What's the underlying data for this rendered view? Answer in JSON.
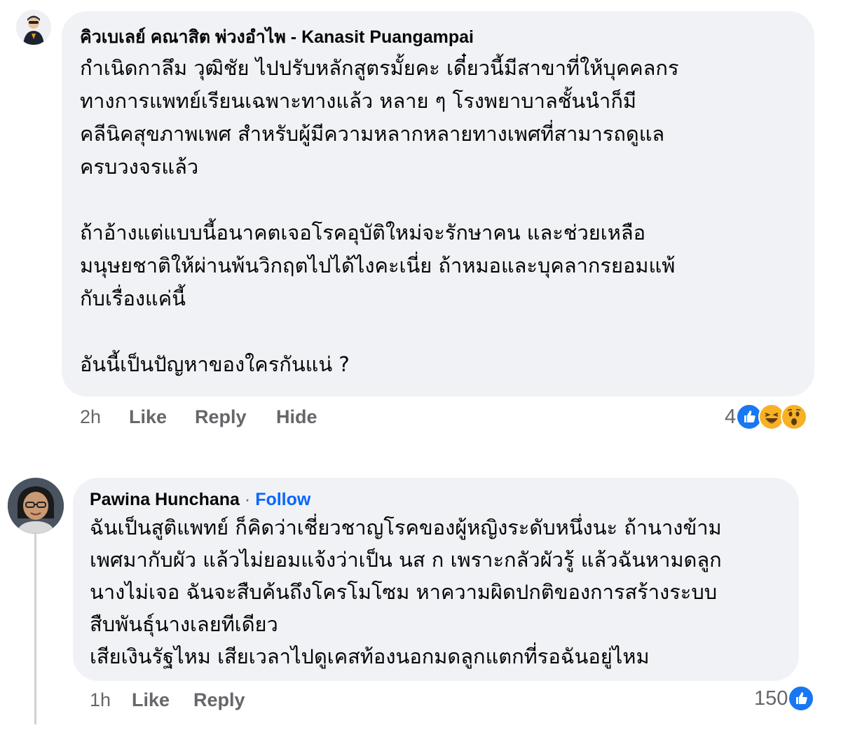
{
  "comments": [
    {
      "author": "คิวเบเลย์ คณาสิต พ่วงอำไพ - Kanasit Puangampai",
      "paragraphs": [
        [
          "กำเนิดกาลึม วุฒิชัย ไปปรับหลักสูตรมั้ยคะ เดี๋ยวนี้มีสาขาที่ให้บุคคลกร",
          "ทางการแพทย์เรียนเฉพาะทางแล้ว หลาย ๆ โรงพยาบาลชั้นนำก็มี",
          "คลีนิคสุขภาพเพศ สำหรับผู้มีความหลากหลายทางเพศที่สามารถดูแล",
          "ครบวงจรแล้ว"
        ],
        [
          "ถ้าอ้างแต่แบบนี้อนาคตเจอโรคอุบัติใหม่จะรักษาคน และช่วยเหลือ",
          "มนุษยชาติให้ผ่านพ้นวิกฤตไปได้ไงคะเนี่ย ถ้าหมอและบุคลากรยอมแพ้",
          "กับเรื่องแค่นี้"
        ],
        [
          "อันนี้เป็นปัญหาของใครกันแน่ ?"
        ]
      ],
      "time": "2h",
      "actions": {
        "like": "Like",
        "reply": "Reply",
        "hide": "Hide"
      },
      "reactions": {
        "count": "4",
        "icons": [
          "like-icon",
          "haha-icon",
          "wow-icon"
        ]
      }
    },
    {
      "author": "Pawina Hunchana",
      "separator": "·",
      "follow": "Follow",
      "lines": [
        "ฉันเป็นสูติแพทย์ ก็คิดว่าเชี่ยวชาญโรคของผู้หญิงระดับหนึ่งนะ ถ้านางข้าม",
        "เพศมากับผัว แล้วไม่ยอมแจ้งว่าเป็น นส ก เพราะกลัวผัวรู้ แล้วฉันหามดลูก",
        "นางไม่เจอ ฉันจะสืบค้นถึงโครโมโซม หาความผิดปกติของการสร้างระบบ",
        "สืบพันธุ์นางเลยทีเดียว",
        "เสียเงินรัฐไหม เสียเวลาไปดูเคสท้องนอกมดลูกแตกที่รอฉันอยู่ไหม"
      ],
      "time": "1h",
      "actions": {
        "like": "Like",
        "reply": "Reply"
      },
      "reactions": {
        "count": "150",
        "icons": [
          "like-icon"
        ]
      }
    }
  ],
  "colors": {
    "bubble": "#f0f2f5",
    "meta": "#65676b",
    "link": "#0866ff",
    "like": "#1877f2",
    "emoji": "#f7b125"
  }
}
